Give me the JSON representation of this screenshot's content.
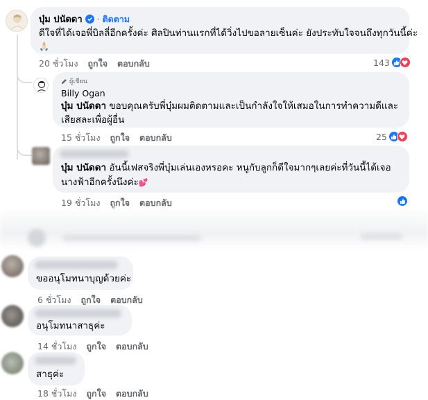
{
  "c1": {
    "author": "บุ๋ม ปนัดดา",
    "follow": "ติดตาม",
    "text": "ดีใจที่ได้เจอพี่บิลลี่อีกครั้งค่ะ ศิลปินท่านแรกที่ได้วิ่งไปขอลายเซ็นค่ะ ยังประทับใจจนถึงทุกวันนี้ค่ะ",
    "emoji": "🙏🏻",
    "time": "20 ชั่วโมง",
    "like": "ถูกใจ",
    "reply": "ตอบกลับ",
    "reactions": "143"
  },
  "c2": {
    "badge": "ผู้เขียน",
    "author": "Billy Ogan",
    "mention": "บุ๋ม ปนัดดา",
    "text": " ขอบคุณครับพี่บุ๋มผมติดตามและเป็นกำลังใจให้เสมอในการทำความดีและเสียสละเพื่อผู้อื่น",
    "time": "15 ชั่วโมง",
    "like": "ถูกใจ",
    "reply": "ตอบกลับ",
    "reactions": "25"
  },
  "c3": {
    "mention": "บุ๋ม ปนัดดา",
    "text": " อันนี้เฟสจริงพี่บุ๋มเล่นเองหรอคะ หนูกับลูกก็ดีใจมากๆเลยค่ะที่วันนี้ได้เจอนางฟ้าอีกครั้งนึงค่ะ",
    "emoji": "💕",
    "time": "19 ชั่วโมง",
    "like": "ถูกใจ",
    "reply": "ตอบกลับ"
  },
  "c4": {
    "text": "ขออนุโมทนาบุญด้วยค่ะ",
    "time": "6 ชั่วโมง",
    "like": "ถูกใจ",
    "reply": "ตอบกลับ"
  },
  "c5": {
    "text": "อนุโมทนาสาธุค่ะ",
    "time": "14 ชั่วโมง",
    "like": "ถูกใจ",
    "reply": "ตอบกลับ"
  },
  "c6": {
    "text": "สาธุค่ะ",
    "time": "18 ชั่วโมง",
    "like": "ถูกใจ",
    "reply": "ตอบกลับ"
  },
  "colors": {
    "like_blue": "#1877f2",
    "love_red": "#f33e58",
    "bubble_bg": "#f0f2f5",
    "meta_gray": "#65676b"
  },
  "icons": [
    "verified-badge-icon",
    "pencil-icon",
    "like-reaction-icon",
    "love-reaction-icon"
  ]
}
